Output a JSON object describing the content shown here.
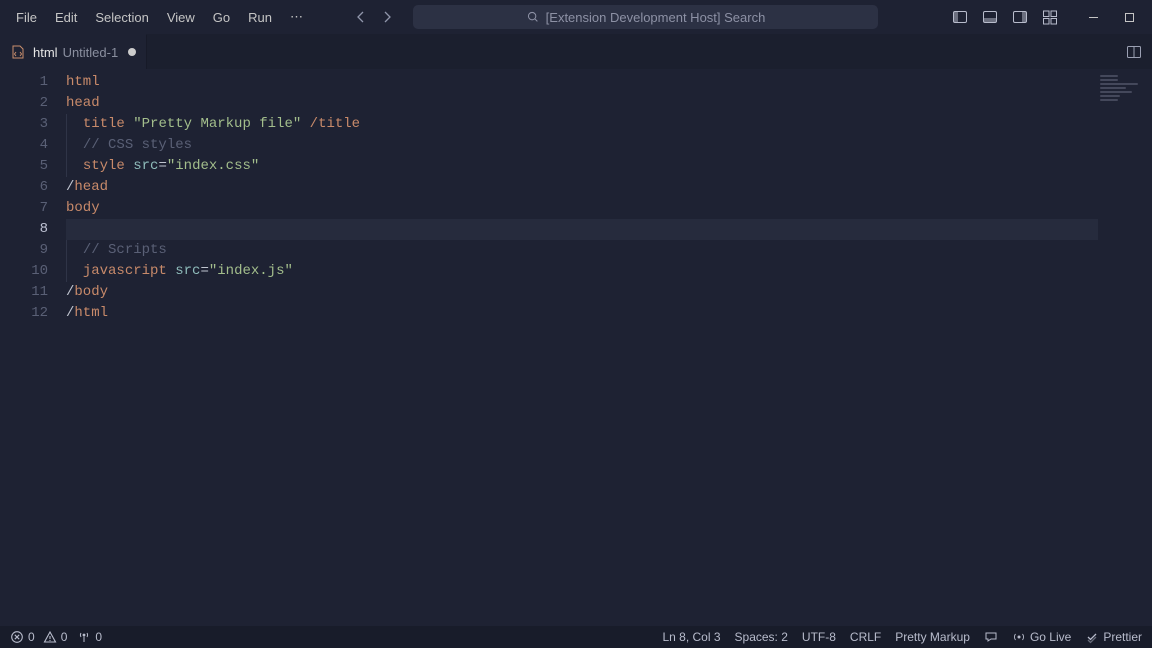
{
  "menu": {
    "items": [
      "File",
      "Edit",
      "Selection",
      "View",
      "Go",
      "Run"
    ],
    "more": "⋯"
  },
  "search": {
    "placeholder": "[Extension Development Host] Search"
  },
  "tab": {
    "language": "html",
    "filename": "Untitled-1"
  },
  "code": {
    "lines": [
      {
        "n": 1,
        "indent": 0,
        "segs": [
          [
            "html",
            "tag"
          ]
        ]
      },
      {
        "n": 2,
        "indent": 0,
        "segs": [
          [
            "head",
            "tag"
          ]
        ]
      },
      {
        "n": 3,
        "indent": 1,
        "segs": [
          [
            "title ",
            "tag"
          ],
          [
            "\"Pretty Markup file\"",
            "str"
          ],
          [
            " /",
            "tag"
          ],
          [
            "title",
            "tag"
          ]
        ]
      },
      {
        "n": 4,
        "indent": 1,
        "segs": [
          [
            "// CSS styles",
            "comment"
          ]
        ]
      },
      {
        "n": 5,
        "indent": 1,
        "segs": [
          [
            "style ",
            "tag"
          ],
          [
            "src",
            "attr"
          ],
          [
            "=",
            "eq"
          ],
          [
            "\"index.css\"",
            "str"
          ]
        ]
      },
      {
        "n": 6,
        "indent": 0,
        "segs": [
          [
            "/",
            "slash"
          ],
          [
            "head",
            "tag"
          ]
        ]
      },
      {
        "n": 7,
        "indent": 0,
        "segs": [
          [
            "body",
            "tag"
          ]
        ]
      },
      {
        "n": 8,
        "indent": 0,
        "segs": [],
        "active": true
      },
      {
        "n": 9,
        "indent": 1,
        "segs": [
          [
            "// Scripts",
            "comment"
          ]
        ]
      },
      {
        "n": 10,
        "indent": 1,
        "segs": [
          [
            "javascript ",
            "tag"
          ],
          [
            "src",
            "attr"
          ],
          [
            "=",
            "eq"
          ],
          [
            "\"index.js\"",
            "str"
          ]
        ]
      },
      {
        "n": 11,
        "indent": 0,
        "segs": [
          [
            "/",
            "slash"
          ],
          [
            "body",
            "tag"
          ]
        ]
      },
      {
        "n": 12,
        "indent": 0,
        "segs": [
          [
            "/",
            "slash"
          ],
          [
            "html",
            "tag"
          ]
        ]
      }
    ]
  },
  "status": {
    "errors": "0",
    "warnings": "0",
    "ports": "0",
    "cursor": "Ln 8, Col 3",
    "spaces": "Spaces: 2",
    "encoding": "UTF-8",
    "eol": "CRLF",
    "language": "Pretty Markup",
    "goLive": "Go Live",
    "prettier": "Prettier"
  }
}
